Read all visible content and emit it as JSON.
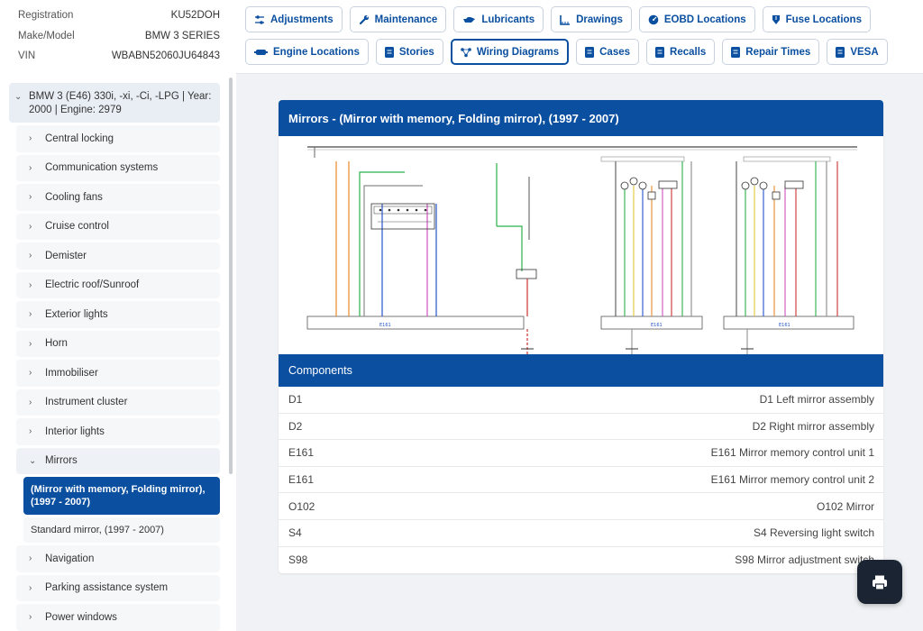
{
  "vehicle": {
    "rows": [
      {
        "label": "Registration",
        "value": "KU52DOH"
      },
      {
        "label": "Make/Model",
        "value": "BMW 3 SERIES"
      },
      {
        "label": "VIN",
        "value": "WBABN52060JU64843"
      }
    ]
  },
  "toolbar": {
    "row1": [
      {
        "label": "Adjustments",
        "icon": "sliders-icon"
      },
      {
        "label": "Maintenance",
        "icon": "wrench-icon"
      },
      {
        "label": "Lubricants",
        "icon": "oil-can-icon"
      },
      {
        "label": "Drawings",
        "icon": "ruler-icon"
      },
      {
        "label": "EOBD Locations",
        "icon": "gauge-icon"
      },
      {
        "label": "Fuse Locations",
        "icon": "fuse-icon"
      }
    ],
    "row2": [
      {
        "label": "Engine Locations",
        "icon": "engine-icon"
      },
      {
        "label": "Stories",
        "icon": "book-icon"
      },
      {
        "label": "Wiring Diagrams",
        "icon": "network-icon",
        "active": true
      },
      {
        "label": "Cases",
        "icon": "book-icon"
      },
      {
        "label": "Recalls",
        "icon": "book-icon"
      },
      {
        "label": "Repair Times",
        "icon": "book-icon"
      },
      {
        "label": "VESA",
        "icon": "book-icon"
      }
    ]
  },
  "sidebar": {
    "vehicle": "BMW 3 (E46) 330i, -xi, -Ci, -LPG | Year: 2000 | Engine: 2979",
    "categories_before": [
      "Central locking",
      "Communication systems",
      "Cooling fans",
      "Cruise control",
      "Demister",
      "Electric roof/Sunroof",
      "Exterior lights",
      "Horn",
      "Immobiliser",
      "Instrument cluster",
      "Interior lights"
    ],
    "open_category": "Mirrors",
    "sub_active": "(Mirror with memory, Folding mirror), (1997 - 2007)",
    "sub_other": "Standard mirror, (1997 - 2007)",
    "categories_after": [
      "Navigation",
      "Parking assistance system",
      "Power windows"
    ]
  },
  "main": {
    "title": "Mirrors - (Mirror with memory, Folding mirror), (1997 - 2007)",
    "components_label": "Components",
    "components": [
      {
        "code": "D1",
        "desc": "D1 Left mirror assembly"
      },
      {
        "code": "D2",
        "desc": "D2 Right mirror assembly"
      },
      {
        "code": "E161",
        "desc": "E161 Mirror memory control unit 1"
      },
      {
        "code": "E161",
        "desc": "E161 Mirror memory control unit 2"
      },
      {
        "code": "O102",
        "desc": "O102 Mirror"
      },
      {
        "code": "S4",
        "desc": "S4 Reversing light switch"
      },
      {
        "code": "S98",
        "desc": "S98 Mirror adjustment switch"
      }
    ],
    "diagram_labels": [
      "E161",
      "E161",
      "E161"
    ]
  },
  "colors": {
    "primary": "#0a4fa0",
    "print_button": "#1a2433"
  }
}
